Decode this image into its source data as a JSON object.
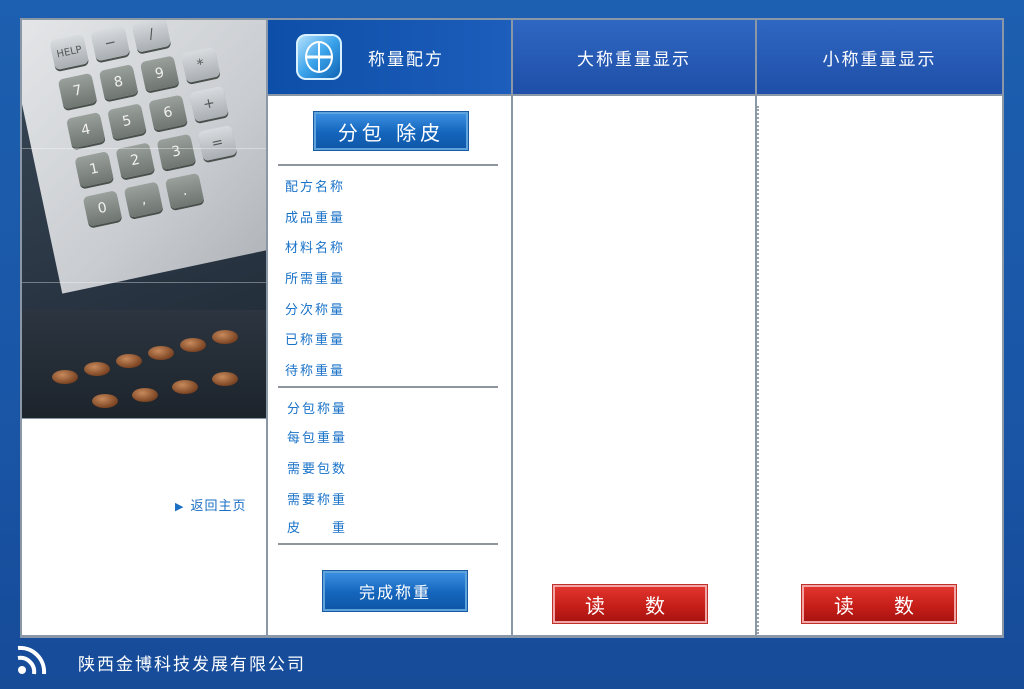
{
  "header": {
    "recipe_title": "称量配方",
    "large_scale_title": "大称重量显示",
    "small_scale_title": "小称重量显示"
  },
  "nav": {
    "back_home": "返回主页"
  },
  "form": {
    "tare_button": "分包 除皮",
    "section1": [
      "配方名称",
      "成品重量",
      "材料名称",
      "所需重量",
      "分次称量",
      "已称重量",
      "待称重量"
    ],
    "section2": [
      "分包称量",
      "每包重量",
      "需要包数",
      "需要称重",
      "皮　　重"
    ],
    "finish_button": "完成称重"
  },
  "displays": {
    "large_read_button": "读　数",
    "small_read_button": "读　数"
  },
  "photo_keys": [
    "HELP",
    "−",
    "/",
    "7",
    "8",
    "9",
    "*",
    "4",
    "5",
    "6",
    "+",
    "1",
    "2",
    "3",
    "=",
    "0",
    ",",
    "."
  ],
  "footer": {
    "company": "陕西金博科技发展有限公司"
  },
  "colors": {
    "background": "#1a55a6",
    "header": "#2f67c2",
    "label_blue": "#1a72c8",
    "read_red": "#c41d18"
  }
}
